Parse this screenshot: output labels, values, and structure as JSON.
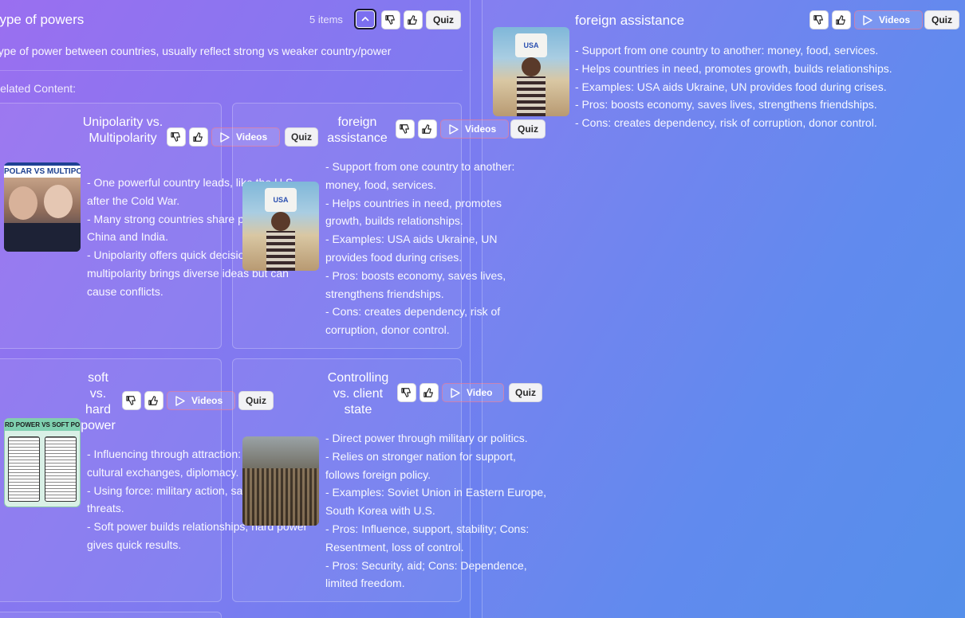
{
  "left": {
    "title": "Type of powers",
    "items_count": "5 items",
    "description": "Type of power between countries, usually reflect strong vs weaker country/power",
    "related_label": "Related Content:",
    "quiz_label": "Quiz"
  },
  "cards": [
    {
      "title": "Unipolarity vs. Multipolarity",
      "videos_label": "Videos",
      "quiz_label": "Quiz",
      "thumb_text": "POLAR VS MULTIPO",
      "bullets": [
        "- One powerful country leads, like the U.S. after the Cold War.",
        "- Many strong countries share power, like China and India.",
        "- Unipolarity offers quick decisions; multipolarity brings diverse ideas but can cause conflicts."
      ]
    },
    {
      "title": "foreign assistance",
      "videos_label": "Videos",
      "quiz_label": "Quiz",
      "thumb_text": "USA",
      "bullets": [
        "- Support from one country to another: money, food, services.",
        "- Helps countries in need, promotes growth, builds relationships.",
        "- Examples: USA aids Ukraine, UN provides food during crises.",
        "- Pros: boosts economy, saves lives, strengthens friendships.",
        "- Cons: creates dependency, risk of corruption, donor control."
      ]
    },
    {
      "title": "soft vs. hard power",
      "videos_label": "Videos",
      "quiz_label": "Quiz",
      "thumb_text": "RD POWER VS SOFT POW",
      "bullets": [
        "- Influencing through attraction: culture, cultural exchanges, diplomacy.",
        "- Using force: military action, sanctions, threats.",
        "- Soft power builds relationships; hard power gives quick results."
      ]
    },
    {
      "title": "Controlling vs. client state",
      "videos_label": "Video",
      "quiz_label": "Quiz",
      "bullets": [
        "- Direct power through military or politics.",
        "- Relies on stronger nation for support, follows foreign policy.",
        "- Examples: Soviet Union in Eastern Europe, South Korea with U.S.",
        "- Pros: Influence, support, stability; Cons: Resentment, loss of control.",
        "- Pros: Security, aid; Cons: Dependence, limited freedom."
      ]
    }
  ],
  "right": {
    "title": "foreign assistance",
    "videos_label": "Videos",
    "quiz_label": "Quiz",
    "thumb_text": "USA",
    "bullets": [
      "- Support from one country to another: money, food, services.",
      "- Helps countries in need, promotes growth, builds relationships.",
      "- Examples: USA aids Ukraine, UN provides food during crises.",
      "- Pros: boosts economy, saves lives, strengthens friendships.",
      "- Cons: creates dependency, risk of corruption, donor control."
    ]
  },
  "colors": {
    "accent": "#7b6ff0",
    "videos_border": "#e67896"
  },
  "icons": [
    "thumbs-down-icon",
    "thumbs-up-icon",
    "play-icon",
    "chevron-up-icon"
  ]
}
